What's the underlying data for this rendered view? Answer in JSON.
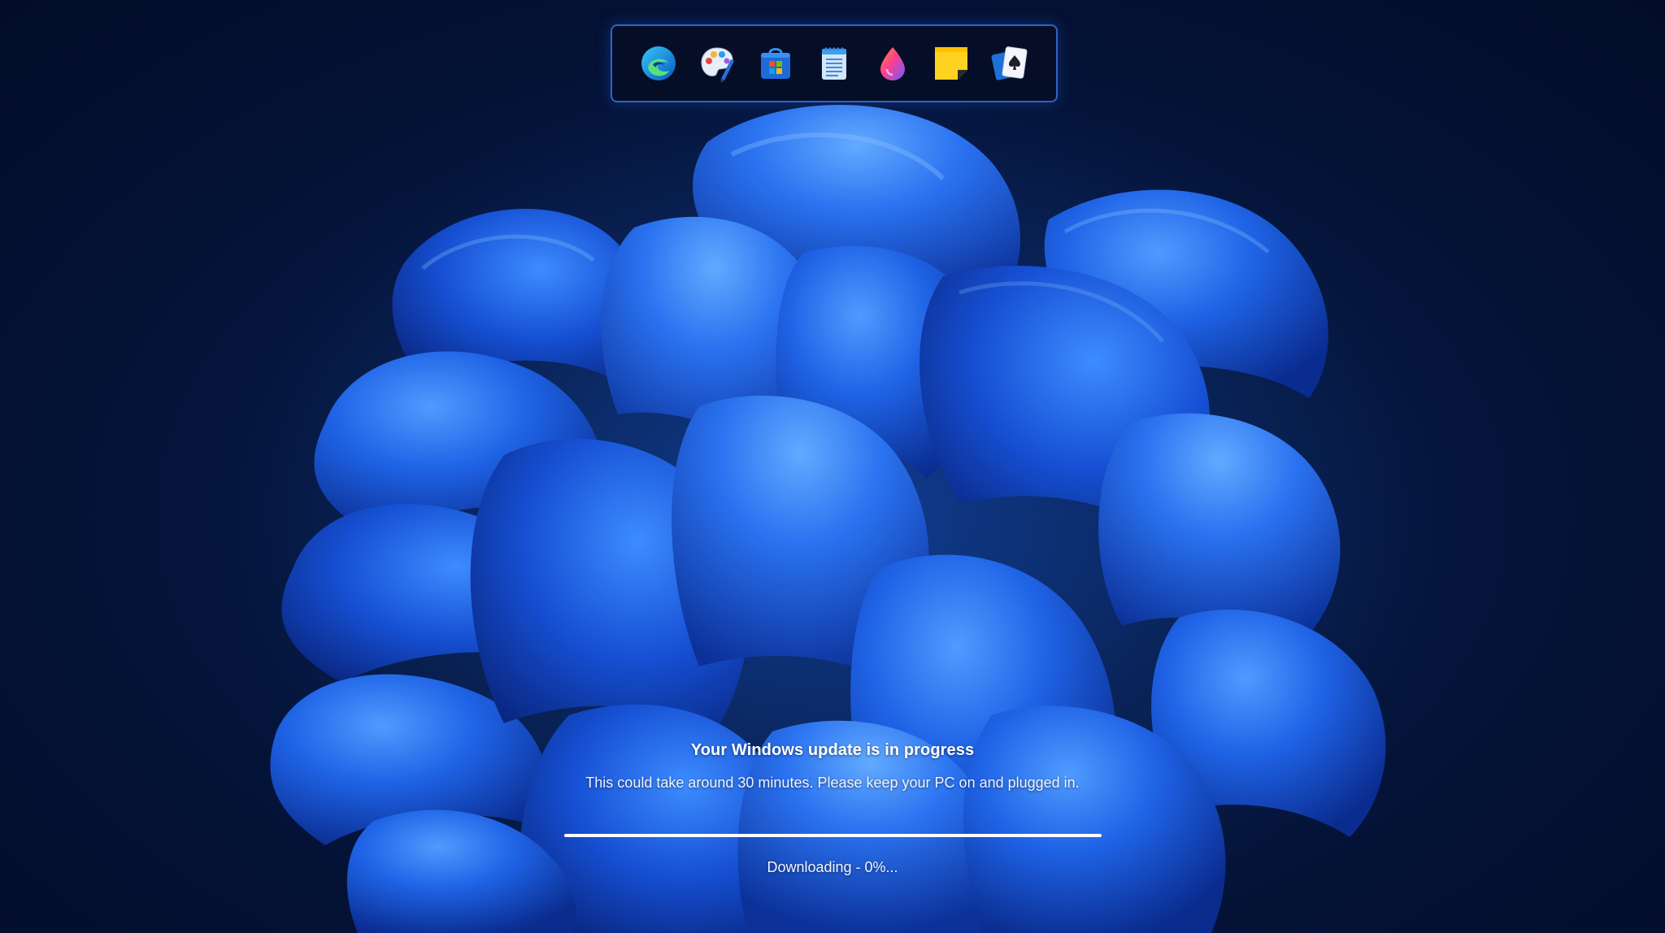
{
  "dock": {
    "apps": [
      {
        "name": "Microsoft Edge",
        "icon": "edge-icon"
      },
      {
        "name": "Paint",
        "icon": "paint-palette-icon"
      },
      {
        "name": "Microsoft Store",
        "icon": "store-bag-icon"
      },
      {
        "name": "Notepad",
        "icon": "notepad-icon"
      },
      {
        "name": "Paint Drop",
        "icon": "color-drop-icon"
      },
      {
        "name": "Sticky Notes",
        "icon": "sticky-notes-icon"
      },
      {
        "name": "Solitaire",
        "icon": "solitaire-cards-icon"
      }
    ]
  },
  "update": {
    "title": "Your Windows update is in progress",
    "subtitle": "This could take around 30 minutes. Please keep your PC on and plugged in.",
    "status": "Downloading - 0%...",
    "progress": 0
  },
  "colors": {
    "background": "#041236",
    "wallpaper_bloom": "#1f63e6",
    "dock_border": "#2e63c9",
    "progress_track": "#ffffff",
    "text": "#ffffff"
  }
}
